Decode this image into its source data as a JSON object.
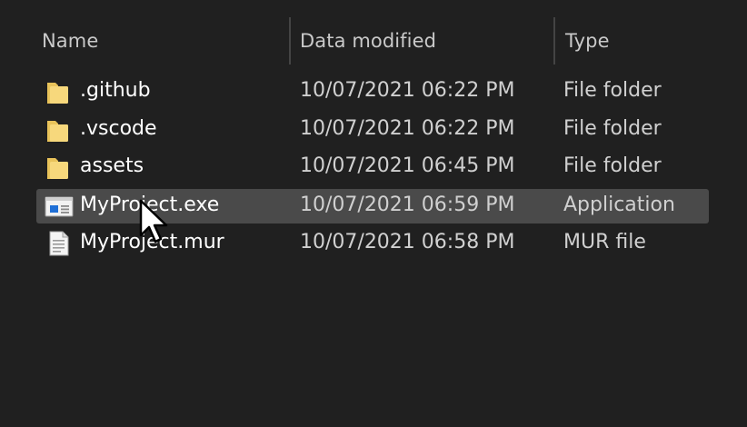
{
  "columns": {
    "name": "Name",
    "date": "Data modified",
    "type": "Type"
  },
  "files": [
    {
      "name": ".github",
      "date": "10/07/2021 06:22 PM",
      "type": "File folder",
      "icon": "folder-icon"
    },
    {
      "name": ".vscode",
      "date": "10/07/2021 06:22 PM",
      "type": "File folder",
      "icon": "folder-icon"
    },
    {
      "name": "assets",
      "date": "10/07/2021 06:45 PM",
      "type": "File folder",
      "icon": "folder-icon"
    },
    {
      "name": "MyProject.exe",
      "date": "10/07/2021 06:59 PM",
      "type": "Application",
      "icon": "application-icon",
      "selected": true
    },
    {
      "name": "MyProject.mur",
      "date": "10/07/2021 06:58 PM",
      "type": "MUR file",
      "icon": "document-icon"
    }
  ],
  "colors": {
    "background": "#202020",
    "selection": "#4a4a4a",
    "folder": "#f7d87c",
    "app_accent": "#1f6fd6"
  }
}
